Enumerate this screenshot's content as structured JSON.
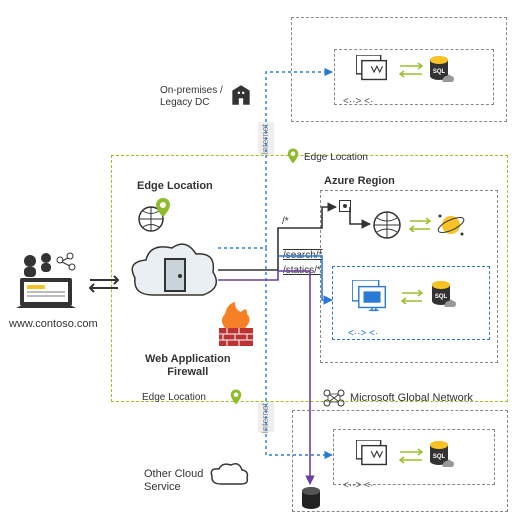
{
  "labels": {
    "onprem": "On-premises /\nLegacy DC",
    "edge_location_inner": "Edge Location",
    "edge_location_right": "Edge Location",
    "edge_location_bottom": "Edge Location",
    "azure_region": "Azure Region",
    "waf": "Web Application\nFirewall",
    "client_url": "www.contoso.com",
    "ms_net": "Microsoft Global Network",
    "other_cloud": "Other Cloud\nService",
    "internet_top": "Internet",
    "internet_bottom": "Internet"
  },
  "routes": {
    "root": "/*",
    "search": "/search/*",
    "statics": "/statics/*"
  },
  "icons": {
    "client": "client-laptop-users",
    "cloud_door": "front-door-cloud",
    "firewall": "waf-firewall",
    "globe_pin": "location-pin-globe",
    "office": "office-building",
    "vm_group": "vm-group",
    "sql": "sql-database",
    "nat": "nat-gateway",
    "cosmos": "cosmos-db",
    "app_gateway": "app-gateway",
    "storage_cyl": "storage-cylinder",
    "arrows": "bidirectional-arrows",
    "cloud_blank": "cloud-outline"
  }
}
